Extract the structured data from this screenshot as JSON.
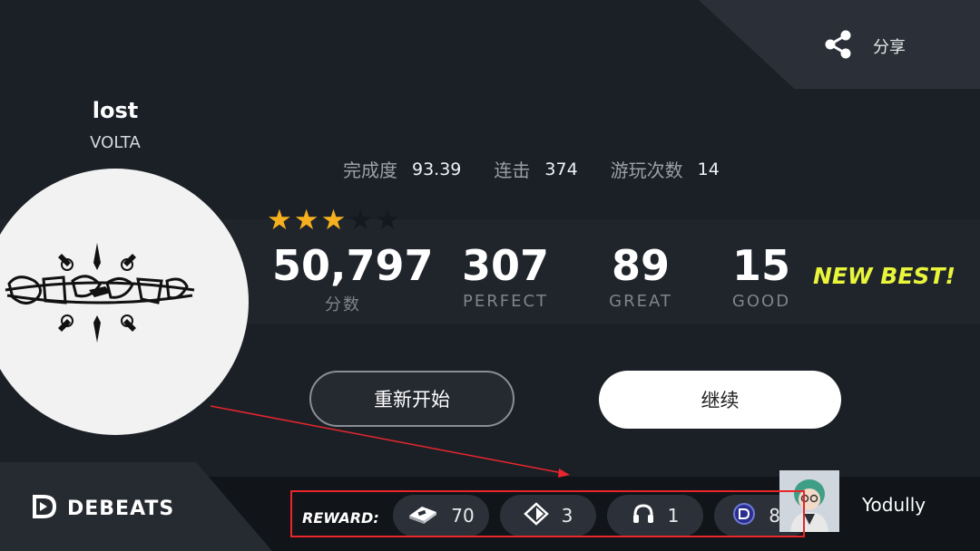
{
  "share": {
    "label": "分享",
    "icon": "share-icon"
  },
  "song": {
    "title": "lost",
    "artist": "VOLTA"
  },
  "metrics": {
    "completion_label": "完成度",
    "completion_value": "93.39",
    "combo_label": "连击",
    "combo_value": "374",
    "plays_label": "游玩次数",
    "plays_value": "14"
  },
  "rating": {
    "stars_filled": 3,
    "stars_total": 5
  },
  "stats": {
    "score_value": "50,797",
    "score_label": "分数",
    "perfect_value": "307",
    "perfect_label": "PERFECT",
    "great_value": "89",
    "great_label": "GREAT",
    "good_value": "15",
    "good_label": "GOOD"
  },
  "badge": {
    "new_best": "NEW BEST!"
  },
  "buttons": {
    "restart": "重新开始",
    "continue": "继续"
  },
  "brand": {
    "name": "DEBEATS"
  },
  "reward": {
    "label": "REWARD:",
    "items": [
      {
        "icon": "ticket-icon",
        "value": "70"
      },
      {
        "icon": "diamond-icon",
        "value": "3"
      },
      {
        "icon": "headphones-icon",
        "value": "1"
      },
      {
        "icon": "coin-icon",
        "value": "80"
      }
    ]
  },
  "user": {
    "name": "Yodully"
  },
  "colors": {
    "background": "#1b2027",
    "star": "#f6b01e",
    "new_best": "#e9f53a",
    "annotation": "#e8262b"
  }
}
